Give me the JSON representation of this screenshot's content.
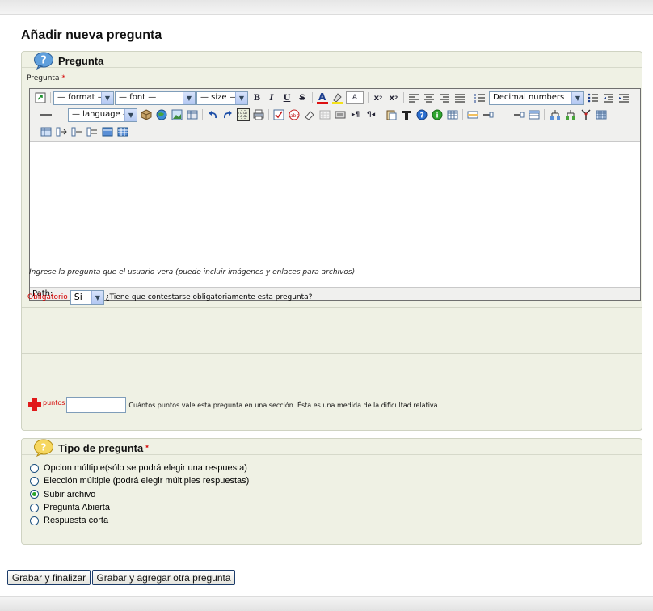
{
  "page": {
    "title": "Añadir nueva pregunta"
  },
  "pregunta_section": {
    "legend": "Pregunta",
    "field_label": "Pregunta",
    "required_mark": "*",
    "editor": {
      "format_select": "— format —",
      "font_select": "— font —",
      "size_select": "— size —",
      "list_style_select": "Decimal numbers",
      "language_select": "— language —",
      "bold": "B",
      "italic": "I",
      "underline": "U",
      "strike": "S",
      "path_label": "Path:"
    },
    "hint": "Ingrese la pregunta que el usuario vera (puede incluir imágenes y enlaces para archivos)",
    "obligatorio": {
      "label": "Obligatorio",
      "value": "Si",
      "question": "¿Tiene que contestarse obligatoriamente esta pregunta?"
    },
    "puntos": {
      "label": "puntos",
      "value": "",
      "description": "Cuántos puntos vale esta pregunta en una sección. Ésta es una medida de la dificultad relativa."
    }
  },
  "tipo_section": {
    "legend": "Tipo de pregunta",
    "required_mark": "*",
    "options": [
      {
        "label": "Opcion múltiple(sólo se podrá elegir una respuesta)",
        "checked": false
      },
      {
        "label": "Elección múltiple (podrá elegir múltiples respuestas)",
        "checked": false
      },
      {
        "label": "Subir archivo",
        "checked": true
      },
      {
        "label": "Pregunta Abierta",
        "checked": false
      },
      {
        "label": "Respuesta corta",
        "checked": false
      }
    ]
  },
  "buttons": {
    "finish": "Grabar y finalizar",
    "add_another": "Grabar y agregar otra pregunta"
  },
  "colors": {
    "fieldset_bg": "#eff1e4",
    "required_red": "#d40000",
    "radio_checked": "#2aa52a"
  }
}
